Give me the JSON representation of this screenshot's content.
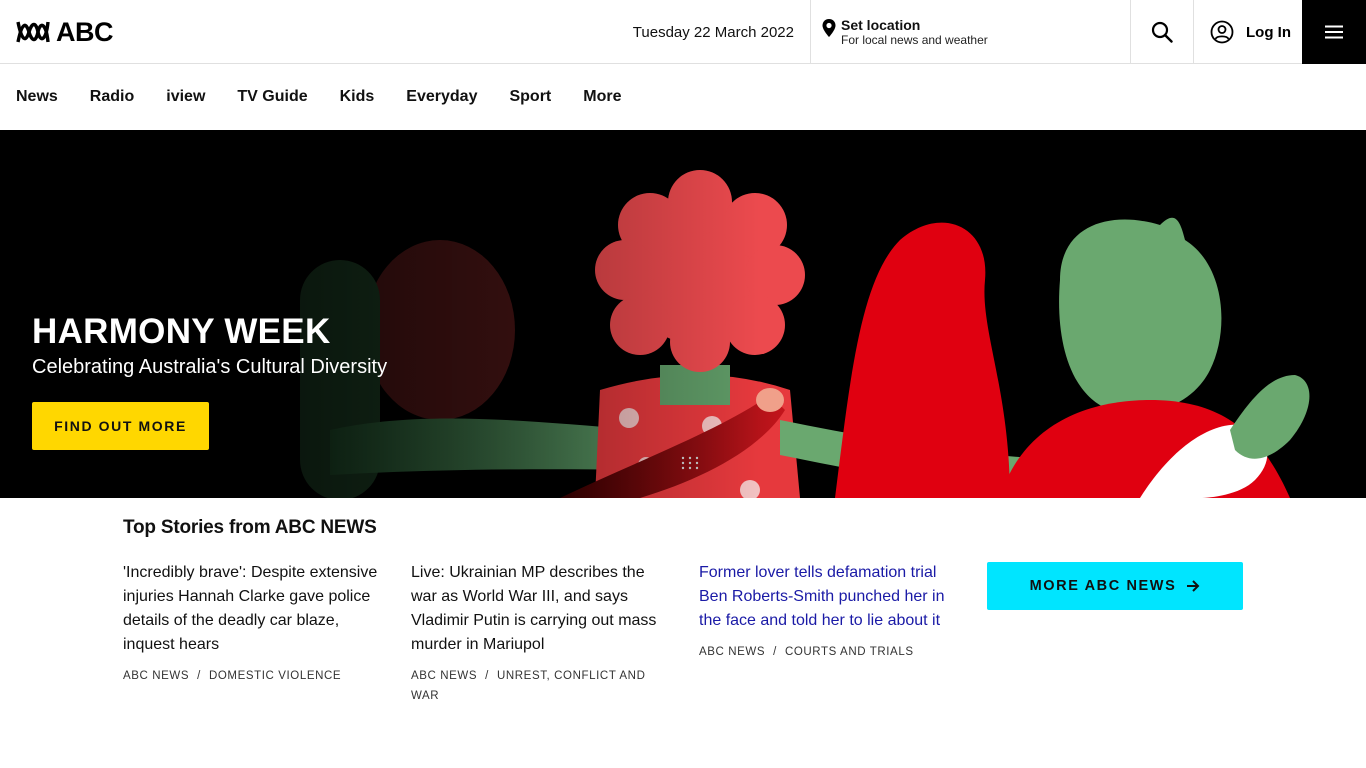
{
  "header": {
    "logo_text": "ABC",
    "date": "Tuesday 22 March 2022",
    "location_title": "Set location",
    "location_subtitle": "For local news and weather",
    "login_label": "Log In"
  },
  "nav": {
    "items": [
      {
        "label": "News"
      },
      {
        "label": "Radio"
      },
      {
        "label": "iview"
      },
      {
        "label": "TV Guide"
      },
      {
        "label": "Kids"
      },
      {
        "label": "Everyday"
      },
      {
        "label": "Sport"
      },
      {
        "label": "More"
      }
    ]
  },
  "hero": {
    "title": "HARMONY WEEK",
    "subtitle": "Celebrating Australia's Cultural Diversity",
    "cta_label": "FIND OUT MORE"
  },
  "top_stories": {
    "heading": "Top Stories from ABC NEWS",
    "stories": [
      {
        "title": "'Incredibly brave': Despite extensive injuries Hannah Clarke gave police details of the deadly car blaze, inquest hears",
        "source": "ABC NEWS",
        "topic": "DOMESTIC VIOLENCE"
      },
      {
        "title": "Live: Ukrainian MP describes the war as World War III, and says Vladimir Putin is carrying out mass murder in Mariupol",
        "source": "ABC NEWS",
        "topic": "UNREST, CONFLICT AND WAR"
      },
      {
        "title": "Former lover tells defamation trial Ben Roberts-Smith punched her in the face and told her to lie about it",
        "source": "ABC NEWS",
        "topic": "COURTS AND TRIALS"
      }
    ],
    "more_label": "MORE ABC NEWS"
  },
  "colors": {
    "cta_yellow": "#ffd700",
    "more_cyan": "#00e5ff",
    "visited_link": "#1a1aa6"
  }
}
